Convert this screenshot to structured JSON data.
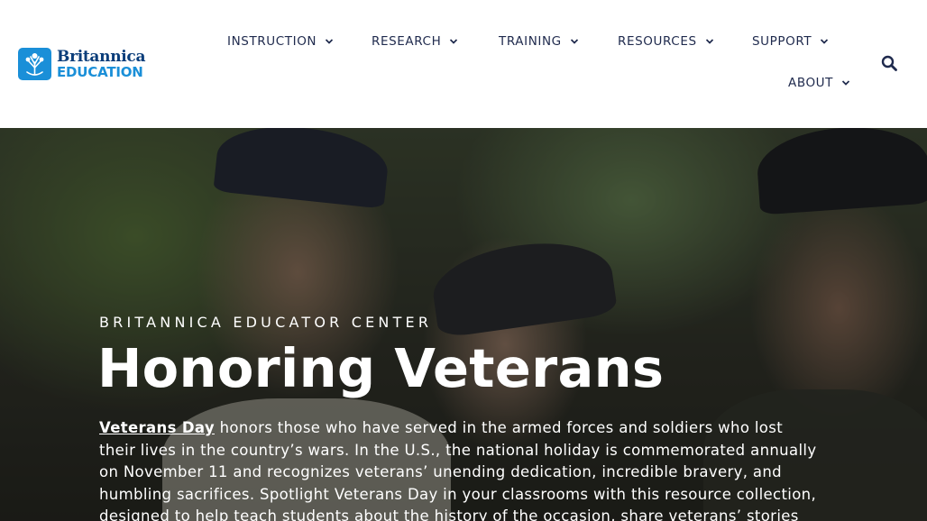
{
  "brand": {
    "name_line1": "Britannica",
    "name_line2": "EDUCATION"
  },
  "nav": {
    "items": [
      {
        "label": "INSTRUCTION"
      },
      {
        "label": "RESEARCH"
      },
      {
        "label": "TRAINING"
      },
      {
        "label": "RESOURCES"
      },
      {
        "label": "SUPPORT"
      },
      {
        "label": "ABOUT"
      }
    ],
    "search_icon": "search-icon",
    "dropdown_icon": "chevron-down-icon"
  },
  "hero": {
    "eyebrow": "BRITANNICA EDUCATOR CENTER",
    "title": "Honoring Veterans",
    "body_link": "Veterans Day",
    "body_text": " honors those who have served in the armed forces and soldiers who lost their lives in the country’s wars. In the U.S., the national holiday is commemorated annually on November 11 and recognizes veterans’ unending dedication, incredible bravery, and humbling sacrifices. Spotlight Veterans Day in your classrooms with this resource collection, designed to help teach students about the history of the occasion, share veterans’ stories"
  },
  "colors": {
    "nav_text": "#1f2a4d",
    "logo_blue": "#1a8fd8",
    "logo_navy": "#0a3d7a",
    "hero_text": "#ffffff"
  }
}
